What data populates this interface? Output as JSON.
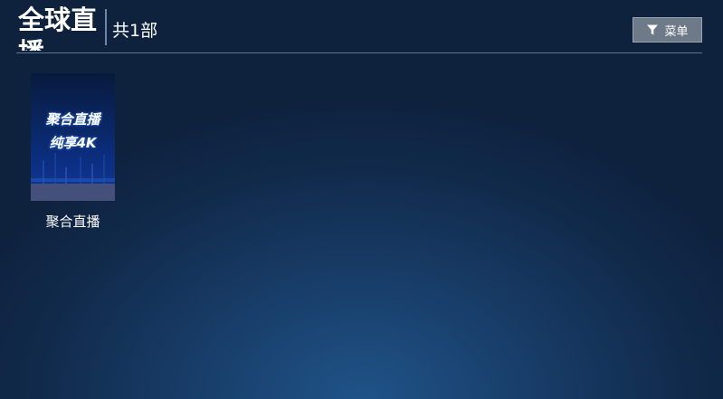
{
  "header": {
    "title": "全球直播",
    "count_text": "共1部",
    "menu_label": "菜单",
    "menu_icon": "filter-icon"
  },
  "items": [
    {
      "title": "聚合直播",
      "poster_line1": "聚合直播",
      "poster_line2": "纯享4K"
    }
  ],
  "colors": {
    "background_center": "#1f5388",
    "background_edge": "#0e213d",
    "menu_button": "#6e7a88",
    "poster_blue": "#0b2f84"
  }
}
